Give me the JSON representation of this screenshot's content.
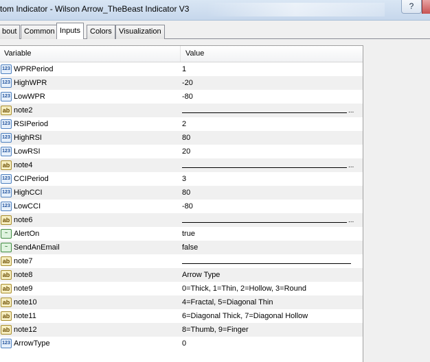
{
  "window": {
    "title": "tom Indicator - Wilson Arrow_TheBeast Indicator V3",
    "help_label": "?"
  },
  "tabs": [
    {
      "label": "bout"
    },
    {
      "label": "Common"
    },
    {
      "label": "Inputs",
      "active": true
    },
    {
      "label": "Colors"
    },
    {
      "label": "Visualization"
    }
  ],
  "grid": {
    "columns": {
      "variable": "Variable",
      "value": "Value"
    },
    "rows": [
      {
        "type": "number",
        "icon_text": "123",
        "name": "WPRPeriod",
        "value": "1"
      },
      {
        "type": "number",
        "icon_text": "123",
        "name": "HighWPR",
        "value": "-20"
      },
      {
        "type": "number",
        "icon_text": "123",
        "name": "LowWPR",
        "value": "-80"
      },
      {
        "type": "string",
        "icon_text": "ab",
        "name": "note2",
        "value": "",
        "separator": true,
        "ellipsis": "..."
      },
      {
        "type": "number",
        "icon_text": "123",
        "name": "RSIPeriod",
        "value": "2"
      },
      {
        "type": "number",
        "icon_text": "123",
        "name": "HighRSI",
        "value": "80"
      },
      {
        "type": "number",
        "icon_text": "123",
        "name": "LowRSI",
        "value": "20"
      },
      {
        "type": "string",
        "icon_text": "ab",
        "name": "note4",
        "value": "",
        "separator": true,
        "ellipsis": "..."
      },
      {
        "type": "number",
        "icon_text": "123",
        "name": "CCIPeriod",
        "value": "3"
      },
      {
        "type": "number",
        "icon_text": "123",
        "name": "HighCCI",
        "value": "80"
      },
      {
        "type": "number",
        "icon_text": "123",
        "name": "LowCCI",
        "value": "-80"
      },
      {
        "type": "string",
        "icon_text": "ab",
        "name": "note6",
        "value": "",
        "separator": true,
        "ellipsis": "..."
      },
      {
        "type": "bool",
        "icon_text": "~",
        "name": "AlertOn",
        "value": "true"
      },
      {
        "type": "bool",
        "icon_text": "~",
        "name": "SendAnEmail",
        "value": "false"
      },
      {
        "type": "string",
        "icon_text": "ab",
        "name": "note7",
        "value": "",
        "separator": true,
        "ellipsis": ""
      },
      {
        "type": "string",
        "icon_text": "ab",
        "name": "note8",
        "value": "Arrow Type"
      },
      {
        "type": "string",
        "icon_text": "ab",
        "name": "note9",
        "value": "0=Thick, 1=Thin, 2=Hollow, 3=Round"
      },
      {
        "type": "string",
        "icon_text": "ab",
        "name": "note10",
        "value": "4=Fractal, 5=Diagonal Thin"
      },
      {
        "type": "string",
        "icon_text": "ab",
        "name": "note11",
        "value": "6=Diagonal Thick, 7=Diagonal Hollow"
      },
      {
        "type": "string",
        "icon_text": "ab",
        "name": "note12",
        "value": "8=Thumb, 9=Finger"
      },
      {
        "type": "number",
        "icon_text": "123",
        "name": "ArrowType",
        "value": "0"
      }
    ]
  },
  "colors": {
    "row_alt": "#f0f0f0",
    "title_bar": "#c6d7ec",
    "number_icon": "#4c7fbf",
    "string_icon": "#a88c2c",
    "bool_icon": "#3f8a3f"
  }
}
